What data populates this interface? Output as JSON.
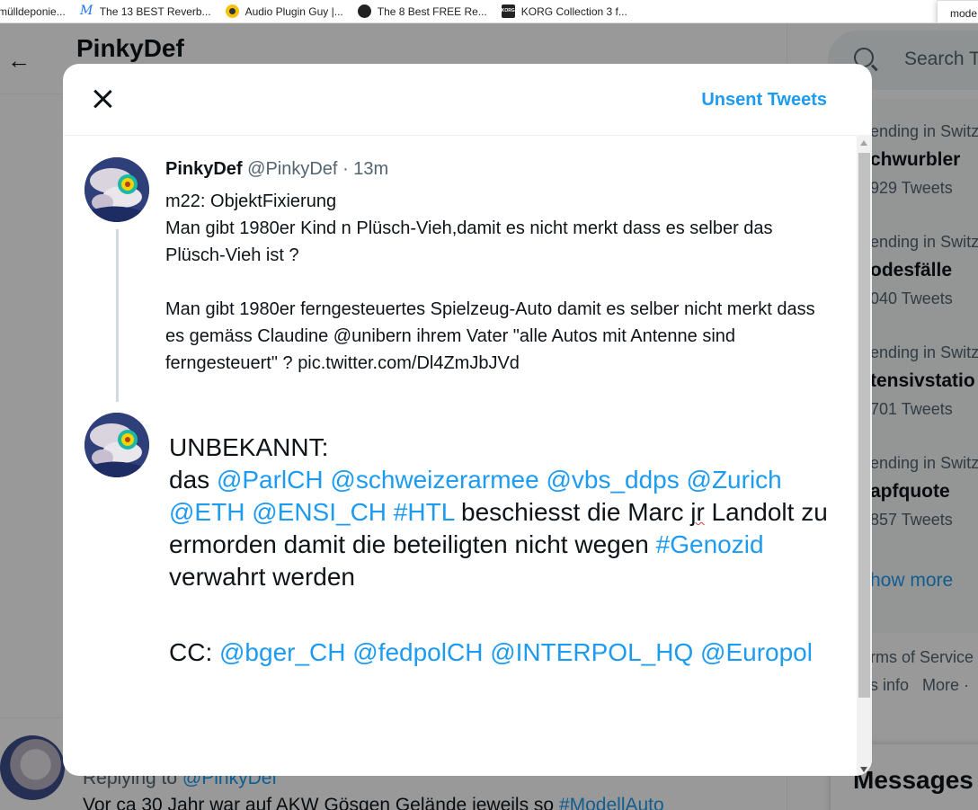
{
  "browser": {
    "bookmarks": [
      {
        "label": "mülldeponie...",
        "icon": "none"
      },
      {
        "label": "The 13 BEST Reverb...",
        "icon": "m-logo-icon"
      },
      {
        "label": "Audio Plugin Guy |...",
        "icon": "audio-plugin-guy-icon"
      },
      {
        "label": "The 8 Best FREE Re...",
        "icon": "dark-circle-icon"
      },
      {
        "label": "KORG Collection 3 f...",
        "icon": "korg-icon"
      }
    ],
    "popup_text": "mode"
  },
  "background": {
    "profile_title": "PinkyDef",
    "search_placeholder": "Search T",
    "trends": [
      {
        "context": "ending in Switz",
        "name": "chwurbler",
        "count": "929 Tweets"
      },
      {
        "context": "ending in Switz",
        "name": "odesfälle",
        "count": "040 Tweets"
      },
      {
        "context": "ending in Switz",
        "name": "tensivstatio",
        "count": "701 Tweets"
      },
      {
        "context": "ending in Switz",
        "name": "apfquote",
        "count": "857 Tweets"
      }
    ],
    "show_more": "how more",
    "footer_line1": "rms of Service",
    "footer_line2_a": "s info",
    "footer_line2_b": "More ·",
    "messages_label": "Messages",
    "replying_prefix": "Replying to ",
    "replying_mention": "@PinkyDef",
    "bottom_text": "Vor ca 30 Jahr war auf AKW Gösgen Gelände jeweils so ",
    "bottom_tag": "#ModellAuto"
  },
  "modal": {
    "unsent_tweets_label": "Unsent Tweets",
    "tweet": {
      "name": "PinkyDef",
      "handle": "@PinkyDef",
      "separator": "·",
      "time": "13m",
      "line1": "m22: ObjektFixierung",
      "para1": "Man gibt 1980er Kind n Plüsch-Vieh,damit es nicht merkt dass es selber das Plüsch-Vieh ist ?",
      "para2": "Man gibt 1980er ferngesteuertes Spielzeug-Auto damit es selber nicht merkt dass es gemäss Claudine @unibern ihrem Vater \"alle Autos mit Antenne sind ferngesteuert\" ? pic.twitter.com/Dl4ZmJbJVd"
    },
    "compose": {
      "heading": "UNBEKANNT:",
      "word_das": "das ",
      "m1": "@ParlCH",
      "m2": "@schweizerarmee",
      "m3": "@vbs_ddps",
      "m4": "@Zurich",
      "m5": "@ETH",
      "m6": "@ENSI_CH",
      "m7": "#HTL",
      "text1": " beschiesst die Marc ",
      "misspelled": "jr",
      "text2": " Landolt zu ermorden damit die beteiligten nicht wegen ",
      "m8": "#Genozid",
      "text3": " verwahrt werden",
      "cc_label": "CC: ",
      "cc1": "@bger_CH",
      "cc2": "@fedpolCH",
      "cc3": "@INTERPOL_HQ",
      "cc4": "@Europol"
    }
  },
  "colors": {
    "accent": "#1d9bf0",
    "text": "#0f1419",
    "muted": "#536471",
    "overlay": "rgba(0,0,0,0.4)"
  }
}
